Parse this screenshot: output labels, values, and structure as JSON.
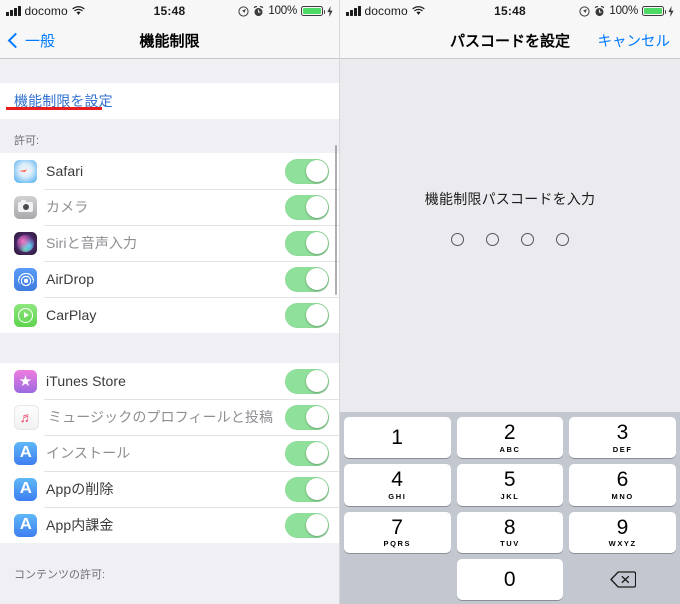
{
  "statusbar": {
    "carrier": "docomo",
    "time": "15:48",
    "battery_pct": "100%",
    "icons": {
      "signal": "signal-bars-icon",
      "wifi": "wifi-icon",
      "location": "location-services-icon",
      "alarm": "alarm-clock-icon",
      "battery": "battery-charging-icon"
    }
  },
  "left": {
    "nav": {
      "back_label": "一般",
      "title": "機能制限"
    },
    "set_restrictions": {
      "label": "機能制限を設定",
      "annotated": true
    },
    "section1_header": "許可:",
    "section1_rows": [
      {
        "label": "Safari",
        "icon": "safari-icon",
        "toggle": "on",
        "dim": false
      },
      {
        "label": "カメラ",
        "icon": "camera-icon",
        "toggle": "on",
        "dim": true
      },
      {
        "label": "Siriと音声入力",
        "icon": "siri-icon",
        "toggle": "on",
        "dim": true
      },
      {
        "label": "AirDrop",
        "icon": "airdrop-icon",
        "toggle": "on",
        "dim": false
      },
      {
        "label": "CarPlay",
        "icon": "carplay-icon",
        "toggle": "on",
        "dim": false
      }
    ],
    "section2_rows": [
      {
        "label": "iTunes Store",
        "icon": "itunes-store-icon",
        "toggle": "on",
        "dim": false
      },
      {
        "label": "ミュージックのプロフィールと投稿",
        "icon": "music-icon",
        "toggle": "on",
        "dim": true
      },
      {
        "label": "インストール",
        "icon": "app-store-icon",
        "toggle": "on",
        "dim": true
      },
      {
        "label": "Appの削除",
        "icon": "app-store-icon",
        "toggle": "on",
        "dim": false
      },
      {
        "label": "App内課金",
        "icon": "app-store-icon",
        "toggle": "on",
        "dim": false
      }
    ],
    "section3_header": "コンテンツの許可:"
  },
  "right": {
    "nav": {
      "title": "パスコードを設定",
      "cancel_label": "キャンセル"
    },
    "passcode_prompt": "機能制限パスコードを入力",
    "passcode_dots": 4,
    "passcode_filled": 0,
    "keypad": [
      [
        {
          "num": "1",
          "letters": ""
        },
        {
          "num": "2",
          "letters": "ABC"
        },
        {
          "num": "3",
          "letters": "DEF"
        }
      ],
      [
        {
          "num": "4",
          "letters": "GHI"
        },
        {
          "num": "5",
          "letters": "JKL"
        },
        {
          "num": "6",
          "letters": "MNO"
        }
      ],
      [
        {
          "num": "7",
          "letters": "PQRS"
        },
        {
          "num": "8",
          "letters": "TUV"
        },
        {
          "num": "9",
          "letters": "WXYZ"
        }
      ],
      [
        {
          "num": "",
          "letters": ""
        },
        {
          "num": "0",
          "letters": ""
        },
        {
          "num": "delete-icon",
          "letters": ""
        }
      ]
    ]
  },
  "colors": {
    "accent_blue": "#007aff",
    "annotation_red": "#e81c1c",
    "toggle_on_green": "#8fe09a",
    "keypad_bg": "#c3c8d0",
    "panel_bg": "#efeff4"
  }
}
